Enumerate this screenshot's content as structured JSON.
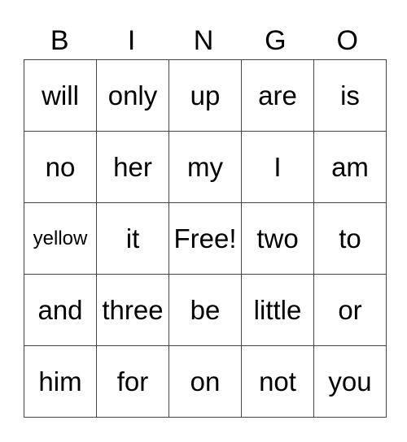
{
  "header": [
    "B",
    "I",
    "N",
    "G",
    "O"
  ],
  "rows": [
    [
      "will",
      "only",
      "up",
      "are",
      "is"
    ],
    [
      "no",
      "her",
      "my",
      "I",
      "am"
    ],
    [
      "yellow",
      "it",
      "Free!",
      "two",
      "to"
    ],
    [
      "and",
      "three",
      "be",
      "little",
      "or"
    ],
    [
      "him",
      "for",
      "on",
      "not",
      "you"
    ]
  ]
}
